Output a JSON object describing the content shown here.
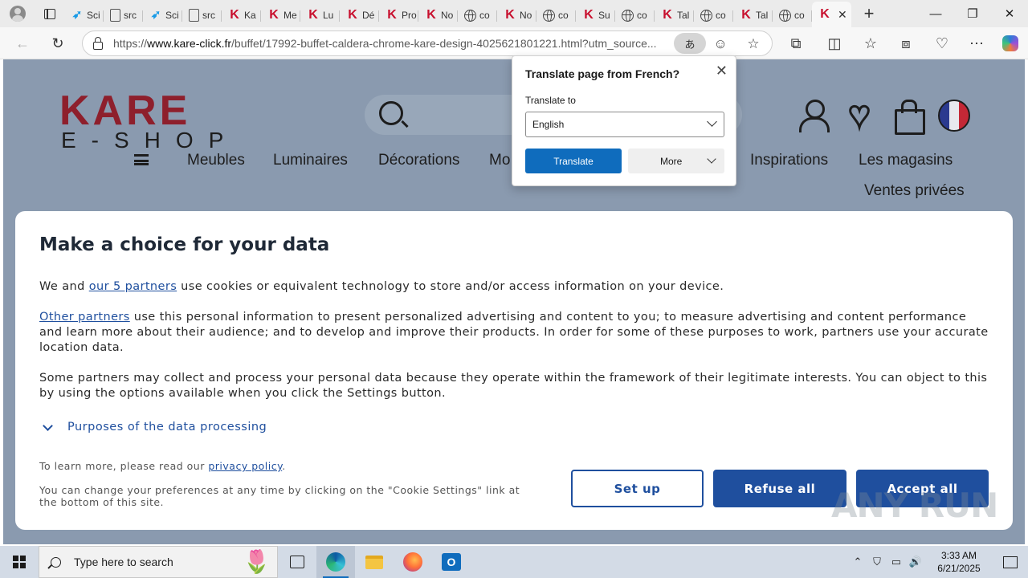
{
  "browser": {
    "tabs": [
      {
        "icon": "bird",
        "title": "Sci"
      },
      {
        "icon": "doc",
        "title": "src"
      },
      {
        "icon": "bird",
        "title": "Sci"
      },
      {
        "icon": "doc",
        "title": "src"
      },
      {
        "icon": "k",
        "title": "Ka"
      },
      {
        "icon": "kred",
        "title": "Me"
      },
      {
        "icon": "k",
        "title": "Lu"
      },
      {
        "icon": "k",
        "title": "Dé"
      },
      {
        "icon": "k",
        "title": "Pro"
      },
      {
        "icon": "k",
        "title": "No"
      },
      {
        "icon": "globe",
        "title": "co"
      },
      {
        "icon": "k",
        "title": "No"
      },
      {
        "icon": "globe",
        "title": "co"
      },
      {
        "icon": "k",
        "title": "Su"
      },
      {
        "icon": "globe",
        "title": "co"
      },
      {
        "icon": "k",
        "title": "Tal"
      },
      {
        "icon": "globe",
        "title": "co"
      },
      {
        "icon": "k",
        "title": "Tal"
      },
      {
        "icon": "globe",
        "title": "co"
      },
      {
        "icon": "k",
        "title": "",
        "active": true
      }
    ],
    "new_tab_label": "+",
    "window_controls": {
      "minimize": "—",
      "restore": "❐",
      "close": "✕"
    },
    "url_prefix": "https://",
    "url_host": "www.kare-click.fr",
    "url_path": "/buffet/17992-buffet-caldera-chrome-kare-design-4025621801221.html?utm_source...",
    "translate_indicator": "あ"
  },
  "translate_popup": {
    "title": "Translate page from French?",
    "translate_to_label": "Translate to",
    "selected_language": "English",
    "translate_button": "Translate",
    "more_button": "More",
    "close": "✕"
  },
  "site": {
    "logo_top": "KARE",
    "logo_bottom": "E-SHOP",
    "menu": [
      "Meubles",
      "Luminaires",
      "Décorations",
      "Mo",
      "Inspirations",
      "Les magasins",
      "Ventes privées"
    ]
  },
  "cookie": {
    "title": "Make a choice for your data",
    "p1_before": "We and ",
    "p1_link": "our 5 partners",
    "p1_after": " use cookies or equivalent technology to store and/or access information on your device.",
    "p2_link": "Other partners",
    "p2_after": " use this personal information to present personalized advertising and content to you; to measure advertising and content performance and learn more about their audience; and to develop and improve their products. In order for some of these purposes to work, partners use your accurate location data.",
    "p3": "Some partners may collect and process your personal data because they operate within the framework of their legitimate interests. You can object to this by using the options available when you click the Settings button.",
    "purposes": "Purposes of the data processing",
    "learn_before": "To learn more, please read our ",
    "learn_link": "privacy policy",
    "learn_after": ".",
    "change_prefs": "You can change your preferences at any time by clicking on the \"Cookie Settings\" link at the bottom of this site.",
    "setup_button": "Set up",
    "refuse_button": "Refuse all",
    "accept_button": "Accept all"
  },
  "watermark": "ANY RUN",
  "taskbar": {
    "search_placeholder": "Type here to search",
    "time": "3:33 AM",
    "date": "6/21/2025"
  },
  "colors": {
    "kare_red": "#8e1f2c",
    "primary_blue": "#1f4f9e",
    "edge_blue": "#0f6cbd",
    "page_overlay": "#8a9aaf"
  }
}
